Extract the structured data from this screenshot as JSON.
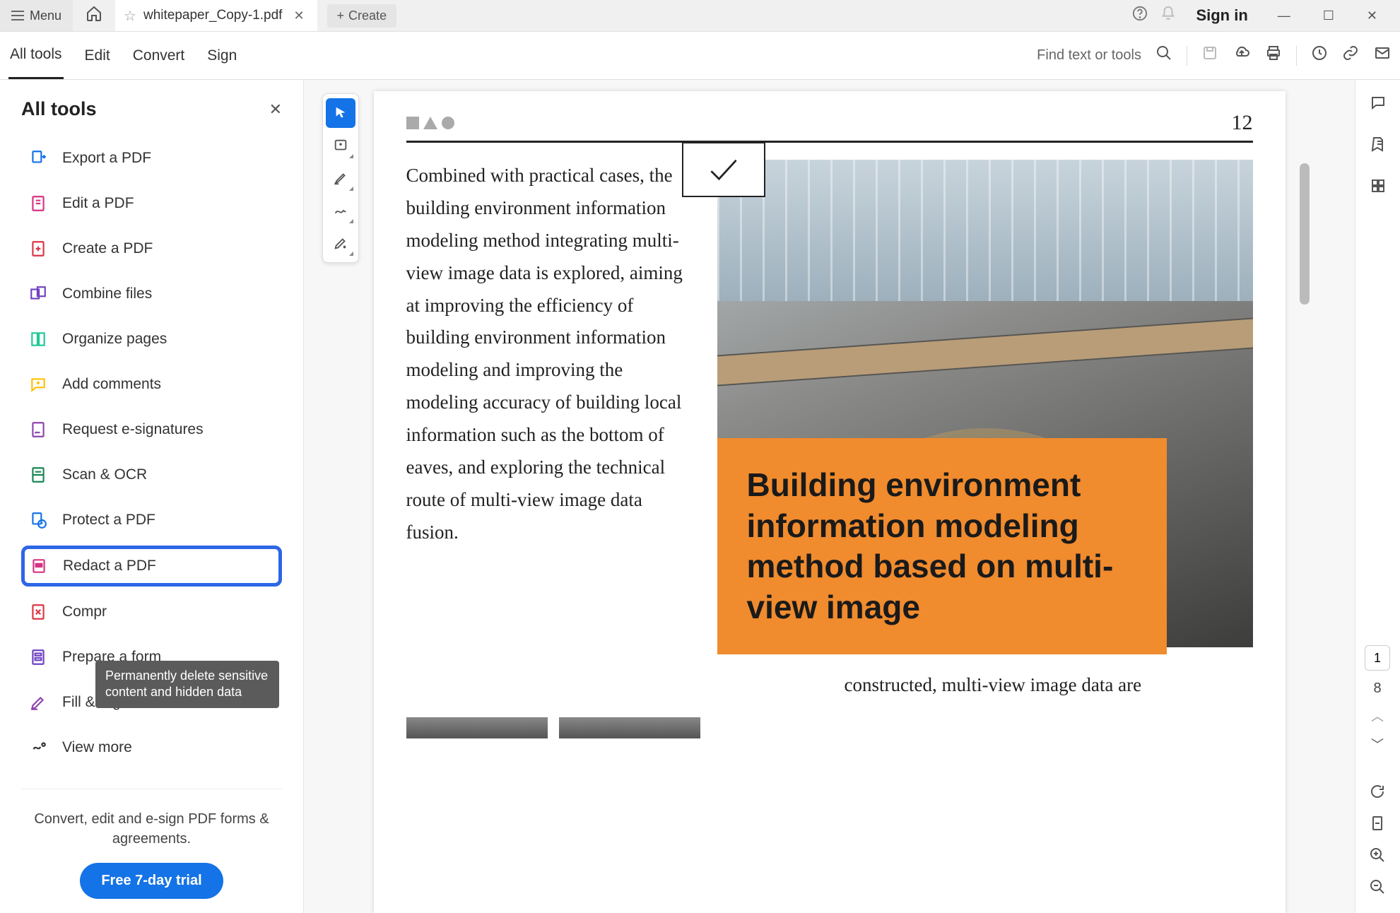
{
  "titlebar": {
    "menu_label": "Menu",
    "tab_filename": "whitepaper_Copy-1.pdf",
    "create_label": "Create",
    "signin_label": "Sign in"
  },
  "toolbar": {
    "tabs": [
      "All tools",
      "Edit",
      "Convert",
      "Sign"
    ],
    "find_label": "Find text or tools"
  },
  "sidebar": {
    "title": "All tools",
    "tools": [
      {
        "label": "Export a PDF",
        "color": "#1473e6",
        "icon": "export"
      },
      {
        "label": "Edit a PDF",
        "color": "#d63384",
        "icon": "edit"
      },
      {
        "label": "Create a PDF",
        "color": "#dc3545",
        "icon": "create"
      },
      {
        "label": "Combine files",
        "color": "#6f42c1",
        "icon": "combine"
      },
      {
        "label": "Organize pages",
        "color": "#20c997",
        "icon": "organize"
      },
      {
        "label": "Add comments",
        "color": "#ffc107",
        "icon": "comment"
      },
      {
        "label": "Request e-signatures",
        "color": "#8e44ad",
        "icon": "esign"
      },
      {
        "label": "Scan & OCR",
        "color": "#198754",
        "icon": "scan"
      },
      {
        "label": "Protect a PDF",
        "color": "#1473e6",
        "icon": "protect"
      },
      {
        "label": "Redact a PDF",
        "color": "#d63384",
        "icon": "redact",
        "highlighted": true
      },
      {
        "label": "Compr",
        "color": "#dc3545",
        "icon": "compress"
      },
      {
        "label": "Prepare a form",
        "color": "#6f42c1",
        "icon": "form"
      },
      {
        "label": "Fill & Sign",
        "color": "#8e44ad",
        "icon": "fillsign"
      },
      {
        "label": "View more",
        "color": "#333",
        "icon": "more"
      }
    ],
    "tooltip": "Permanently delete sensitive content and hidden data",
    "footer_text": "Convert, edit and e-sign PDF forms & agreements.",
    "trial_label": "Free 7-day trial"
  },
  "document": {
    "page_number": "12",
    "body_text": "Combined with practical cases, the building environment information modeling method integrating multi-view image data is explored, aiming at improving the efficiency of building environment information modeling and improving the modeling accuracy of building local information such as the bottom of eaves, and exploring the technical route of multi-view image data fusion.",
    "callout_text": "Building environment information modeling method based on multi-view image",
    "below_text": "constructed, multi-view image data are"
  },
  "page_nav": {
    "current": "1",
    "total": "8"
  }
}
